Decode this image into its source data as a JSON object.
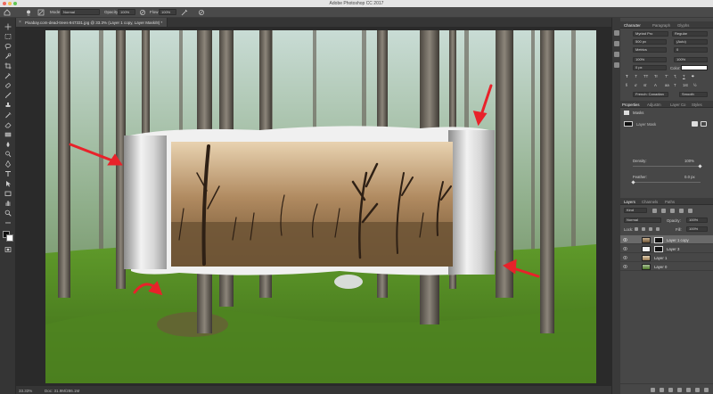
{
  "window": {
    "app_title": "Adobe Photoshop CC 2017",
    "traffic_colors": [
      "#ed6a5e",
      "#f5bf4f",
      "#61c554"
    ]
  },
  "options_bar": {
    "mode_label": "Mode:",
    "mode_value": "Normal",
    "opacity_label": "Opacity:",
    "opacity_value": "100%",
    "flow_label": "Flow:",
    "flow_value": "100%"
  },
  "document": {
    "tab_title": "Pixabay.com-dead-trees-947331.jpg @ 33.3% (Layer 1 copy, Layer Mask/8) *"
  },
  "status": {
    "zoom": "33.33%",
    "doc_size": "Doc: 31.9M/286.1M"
  },
  "panels": {
    "character": {
      "tabs": [
        "Character",
        "Paragraph",
        "Glyphs"
      ],
      "font_family": "Myriad Pro",
      "font_style": "Regular",
      "size": "500 px",
      "leading": "(Auto)",
      "kerning": "Metrics",
      "tracking": "0",
      "vscale": "100%",
      "hscale": "100%",
      "baseline": "0 px",
      "color_label": "Color:",
      "language": "French: Canadian",
      "antialias": "Smooth",
      "fx_buttons": [
        "T",
        "T",
        "TT",
        "Tr",
        "T'",
        "T,",
        "T",
        "T"
      ]
    },
    "properties": {
      "tabs": [
        "Properties",
        "Adjustm",
        "Layer Co",
        "Styles"
      ],
      "title": "Masks",
      "mask_type": "Layer Mask",
      "density_label": "Density:",
      "density_value": "100%",
      "feather_label": "Feather:",
      "feather_value": "0.0 px"
    },
    "layers": {
      "tabs": [
        "Layers",
        "Channels",
        "Paths"
      ],
      "filter_kind": "Kind",
      "blend_mode": "Normal",
      "opacity_label": "Opacity:",
      "opacity_value": "100%",
      "lock_label": "Lock:",
      "fill_label": "Fill:",
      "fill_value": "100%",
      "items": [
        {
          "name": "Layer 1 copy",
          "selected": true,
          "has_mask": true
        },
        {
          "name": "Layer 3",
          "selected": false,
          "has_mask": true
        },
        {
          "name": "Layer 1",
          "selected": false,
          "has_mask": false
        },
        {
          "name": "Layer 0",
          "selected": false,
          "has_mask": false
        }
      ]
    }
  },
  "colors": {
    "panel_bg": "#474747",
    "toolbar_bg": "#353535",
    "canvas_bg": "#2a2a2a",
    "arrow_red": "#e8222a",
    "selected_layer": "#6a6a6a"
  },
  "icons": {
    "toolbar": [
      "move-icon",
      "marquee-icon",
      "lasso-icon",
      "quick-select-icon",
      "crop-icon",
      "eyedropper-icon",
      "healing-icon",
      "brush-icon",
      "clone-stamp-icon",
      "history-brush-icon",
      "eraser-icon",
      "gradient-icon",
      "blur-icon",
      "dodge-icon",
      "pen-icon",
      "type-icon",
      "path-select-icon",
      "rectangle-icon",
      "hand-icon",
      "zoom-icon",
      "more-icon"
    ]
  }
}
